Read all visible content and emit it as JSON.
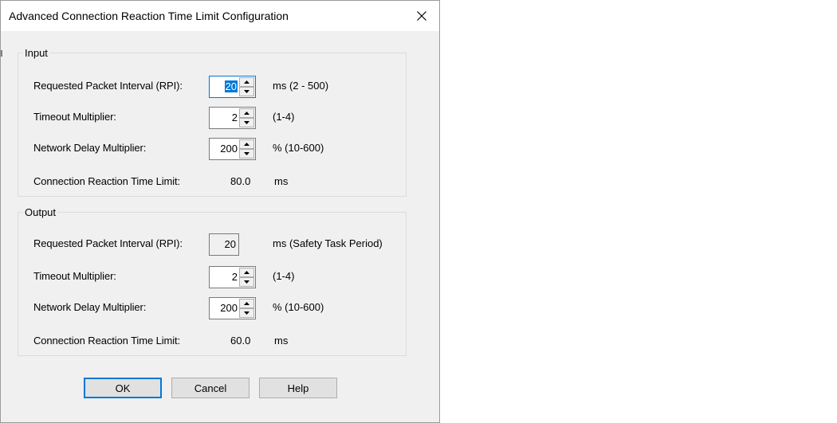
{
  "dialog": {
    "title": "Advanced Connection Reaction Time Limit Configuration"
  },
  "input": {
    "legend": "Input",
    "rpi": {
      "label": "Requested Packet Interval (RPI):",
      "value": "20",
      "unit": "ms (2 - 500)"
    },
    "timeout": {
      "label": "Timeout Multiplier:",
      "value": "2",
      "unit": "(1-4)"
    },
    "network_delay": {
      "label": "Network Delay Multiplier:",
      "value": "200",
      "unit": "% (10-600)"
    },
    "crtl": {
      "label": "Connection Reaction Time Limit:",
      "value": "80.0",
      "unit": "ms"
    }
  },
  "output": {
    "legend": "Output",
    "rpi": {
      "label": "Requested Packet Interval (RPI):",
      "value": "20",
      "unit": "ms (Safety Task Period)"
    },
    "timeout": {
      "label": "Timeout Multiplier:",
      "value": "2",
      "unit": "(1-4)"
    },
    "network_delay": {
      "label": "Network Delay Multiplier:",
      "value": "200",
      "unit": "% (10-600)"
    },
    "crtl": {
      "label": "Connection Reaction Time Limit:",
      "value": "60.0",
      "unit": "ms"
    }
  },
  "buttons": {
    "ok": "OK",
    "cancel": "Cancel",
    "help": "Help"
  },
  "icons": {
    "close": "close-icon",
    "spin_up": "chevron-up-icon",
    "spin_down": "chevron-down-icon"
  },
  "colors": {
    "accent": "#0078d7",
    "dialog_bg": "#f0f0f0"
  }
}
